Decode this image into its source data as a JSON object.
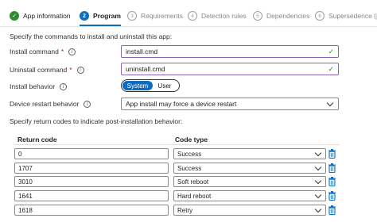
{
  "steps": [
    {
      "num": "✓",
      "label": "App information",
      "state": "done"
    },
    {
      "num": "2",
      "label": "Program",
      "state": "current"
    },
    {
      "num": "3",
      "label": "Requirements",
      "state": "pending"
    },
    {
      "num": "4",
      "label": "Detection rules",
      "state": "pending"
    },
    {
      "num": "5",
      "label": "Dependencies",
      "state": "pending"
    },
    {
      "num": "6",
      "label": "Supersedence (prev",
      "state": "pending"
    }
  ],
  "instruction": "Specify the commands to install and uninstall this app:",
  "fields": {
    "install_label": "Install command",
    "install_value": "install.cmd",
    "uninstall_label": "Uninstall command",
    "uninstall_value": "uninstall.cmd",
    "required_mark": "*",
    "behavior_label": "Install behavior",
    "behavior_options": [
      "System",
      "User"
    ],
    "behavior_selected": "System",
    "restart_label": "Device restart behavior",
    "restart_value": "App install may force a device restart"
  },
  "return_codes": {
    "instruction": "Specify return codes to indicate post-installation behavior:",
    "headers": {
      "code": "Return code",
      "type": "Code type"
    },
    "rows": [
      {
        "code": "0",
        "type": "Success"
      },
      {
        "code": "1707",
        "type": "Success"
      },
      {
        "code": "3010",
        "type": "Soft reboot"
      },
      {
        "code": "1641",
        "type": "Hard reboot"
      },
      {
        "code": "1618",
        "type": "Retry"
      }
    ]
  },
  "colors": {
    "accent": "#0f6cbd",
    "success": "#2e8b2e",
    "focus_border": "#8764b8"
  }
}
